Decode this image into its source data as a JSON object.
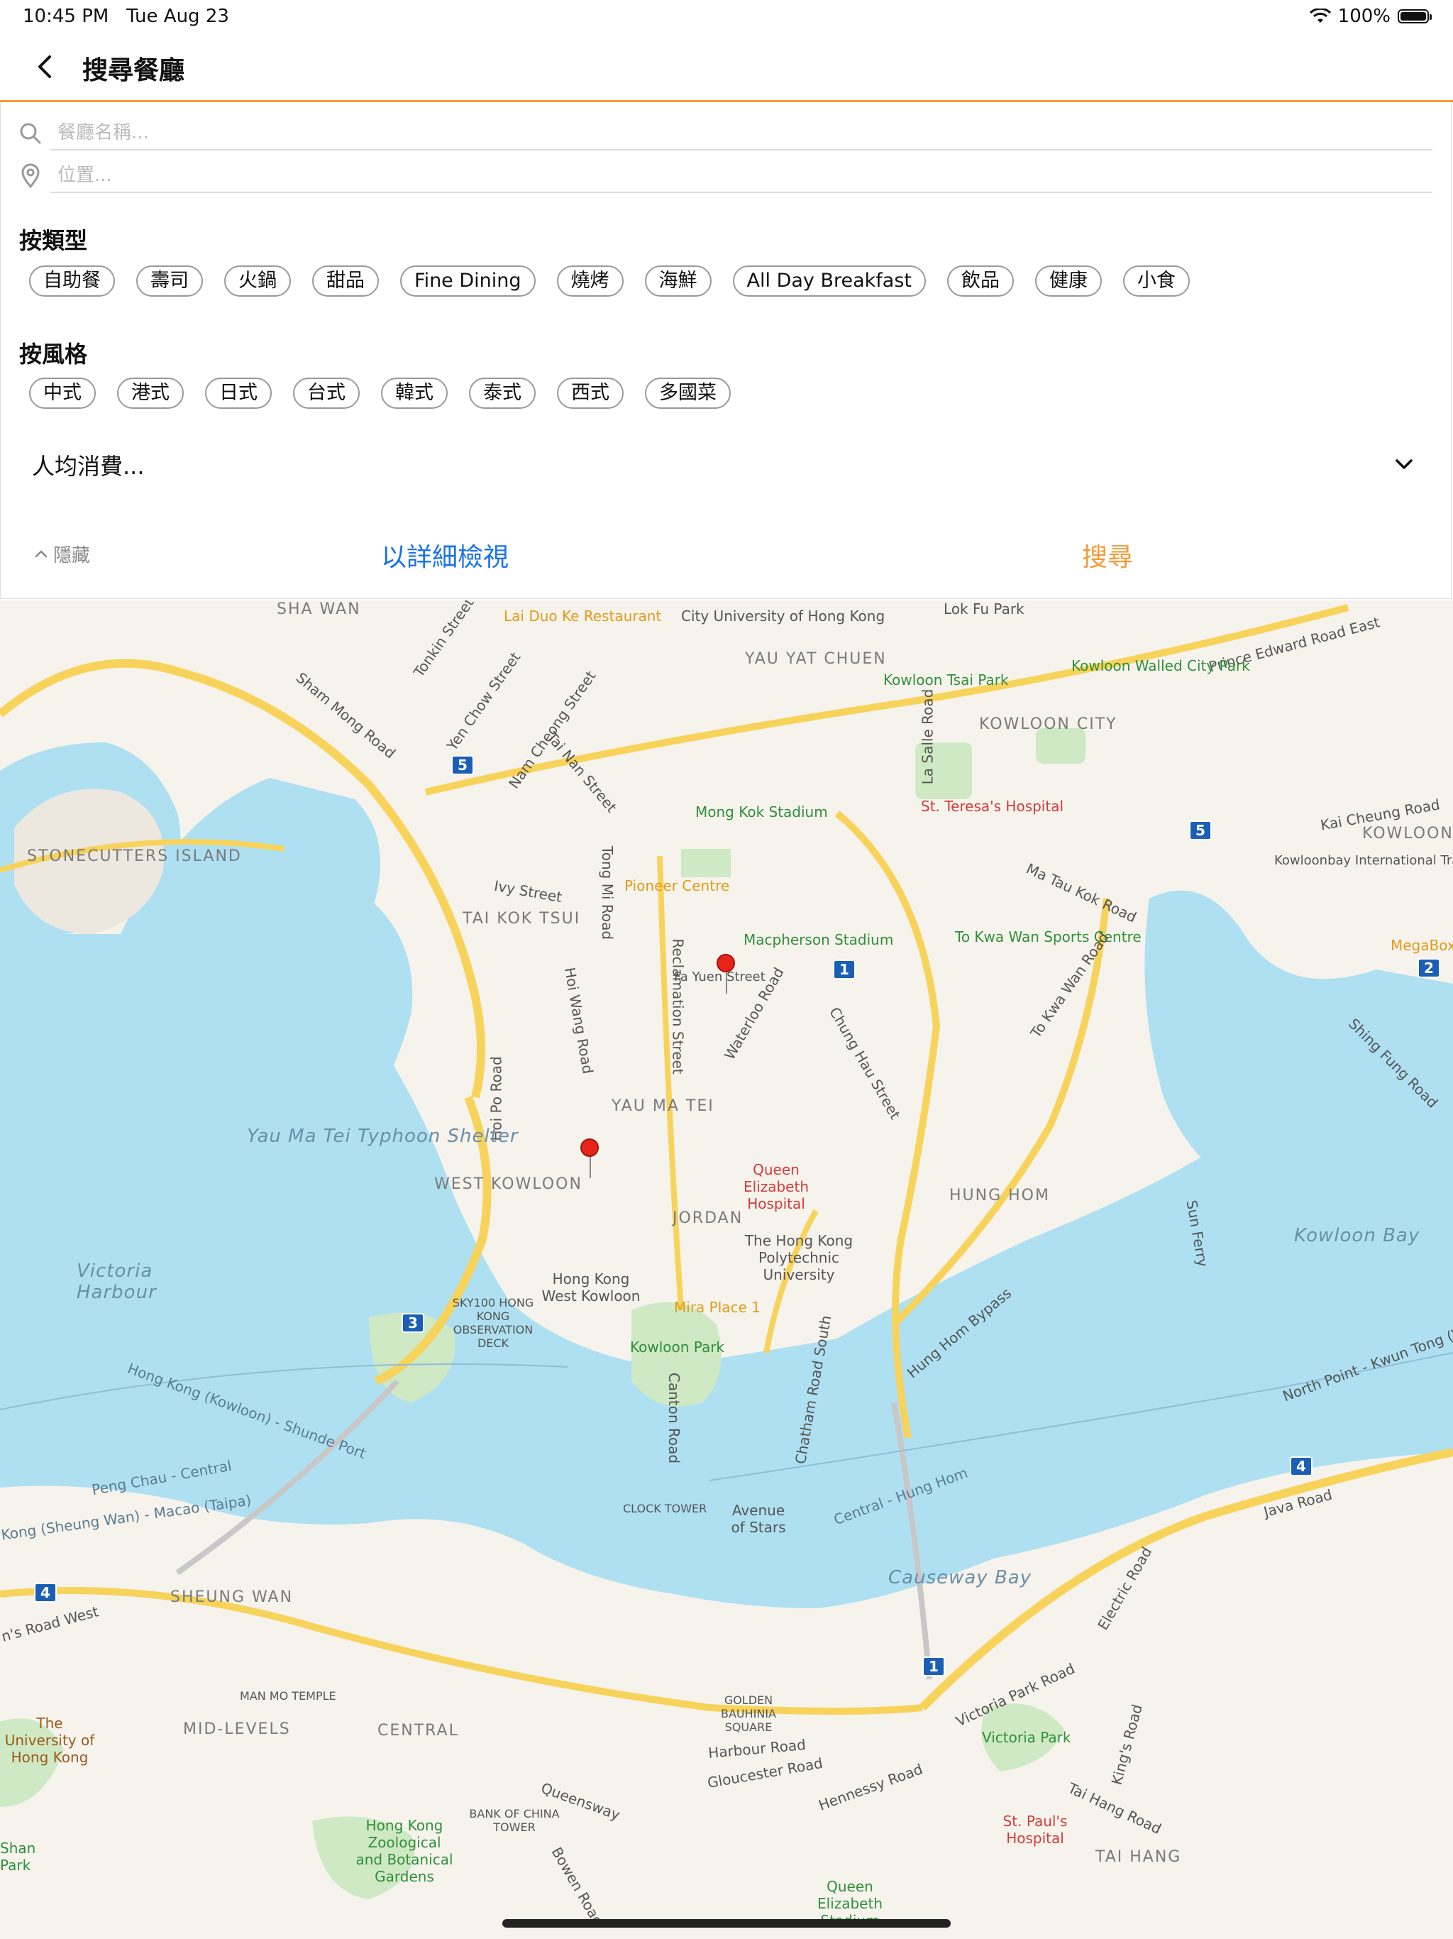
{
  "status_bar": {
    "time": "10:45 PM",
    "date": "Tue Aug 23",
    "battery": "100%"
  },
  "nav": {
    "title": "搜尋餐廳"
  },
  "search": {
    "name_placeholder": "餐廳名稱...",
    "location_placeholder": "位置..."
  },
  "by_type": {
    "title": "按類型",
    "chips": [
      "自助餐",
      "壽司",
      "火鍋",
      "甜品",
      "Fine Dining",
      "燒烤",
      "海鮮",
      "All Day Breakfast",
      "飲品",
      "健康",
      "小食"
    ]
  },
  "by_style": {
    "title": "按風格",
    "chips": [
      "中式",
      "港式",
      "日式",
      "台式",
      "韓式",
      "泰式",
      "西式",
      "多國菜"
    ]
  },
  "price": {
    "placeholder": "人均消費..."
  },
  "actions": {
    "hide": "隱藏",
    "detail_view": "以詳細檢視",
    "search": "搜尋"
  },
  "colors": {
    "accent_orange": "#f39a38",
    "link_blue": "#1a73e8",
    "water": "#aee0f2",
    "land": "#f6f3ec",
    "park": "#cfe9c4",
    "road": "#f7d35b"
  },
  "map": {
    "labels": [
      "SHA WAN",
      "Lai Duo Ke Restaurant",
      "City University of Hong Kong",
      "YAU YAT CHUEN",
      "Lok Fu Park",
      "Prince Edward Road East",
      "Kowloon Tsai Park",
      "Kowloon Walled City Park",
      "KOWLOON CITY",
      "Tonkin Street",
      "Yen Chow Street",
      "Nam Cheong Street",
      "Sham Mong Road",
      "Tai Nan Street",
      "La Salle Road",
      "St. Teresa's Hospital",
      "Kai Cheung Road",
      "KOWLOON",
      "STONECUTTERS ISLAND",
      "Mong Kok Stadium",
      "Pioneer Centre",
      "Tong Mi Road",
      "Ivy Street",
      "TAI KOK TSUI",
      "Ma Tau Kok Road",
      "Kowloonbay International Trade & Exhibition Centre",
      "MegaBox",
      "Macpherson Stadium",
      "Fa Yuen Street",
      "To Kwa Wan Sports Centre",
      "To Kwa Wan Road",
      "Hoi Wang Road",
      "Reclamation Street",
      "Waterloo Road",
      "Chung Hau Street",
      "Shing Fung Road",
      "Hoi Po Road",
      "YAU MA TEI",
      "Yau Ma Tei Typhoon Shelter",
      "WEST KOWLOON",
      "Queen Elizabeth Hospital",
      "HUNG HOM",
      "Sun Ferry",
      "Kowloon Bay",
      "JORDAN",
      "The Hong Kong Polytechnic University",
      "Victoria Harbour",
      "Hong Kong West Kowloon",
      "SKY100 HONG KONG OBSERVATION DECK",
      "Mira Place 1",
      "Kowloon Park",
      "Hung Hom Bypass",
      "Chatham Road South",
      "Canton Road",
      "North Point - Kwun Tong (Via)",
      "Hong Kong (Kowloon) - Shunde Port",
      "Peng Chau - Central",
      "Kong (Sheung Wan) - Macao (Taipa)",
      "CLOCK TOWER",
      "Avenue of Stars",
      "Central - Hung Hom",
      "Java Road",
      "Causeway Bay",
      "Electric Road",
      "SHEUNG WAN",
      "n's Road West",
      "MAN MO TEMPLE",
      "The University of Hong Kong",
      "MID-LEVELS",
      "CENTRAL",
      "GOLDEN BAUHINIA SQUARE",
      "Victoria Park Road",
      "King's Road",
      "Victoria Park",
      "Harbour Road",
      "Gloucester Road",
      "Hennessy Road",
      "Queensway",
      "BANK OF CHINA TOWER",
      "Hong Kong Zoological and Botanical Gardens",
      "St. Paul's Hospital",
      "Tai Hang Road",
      "TAI HANG",
      "Shan Park",
      "Bowen Road",
      "Queen Elizabeth Stadium"
    ],
    "route_shields": [
      "5",
      "5",
      "1",
      "2",
      "3",
      "4",
      "4",
      "1"
    ]
  }
}
